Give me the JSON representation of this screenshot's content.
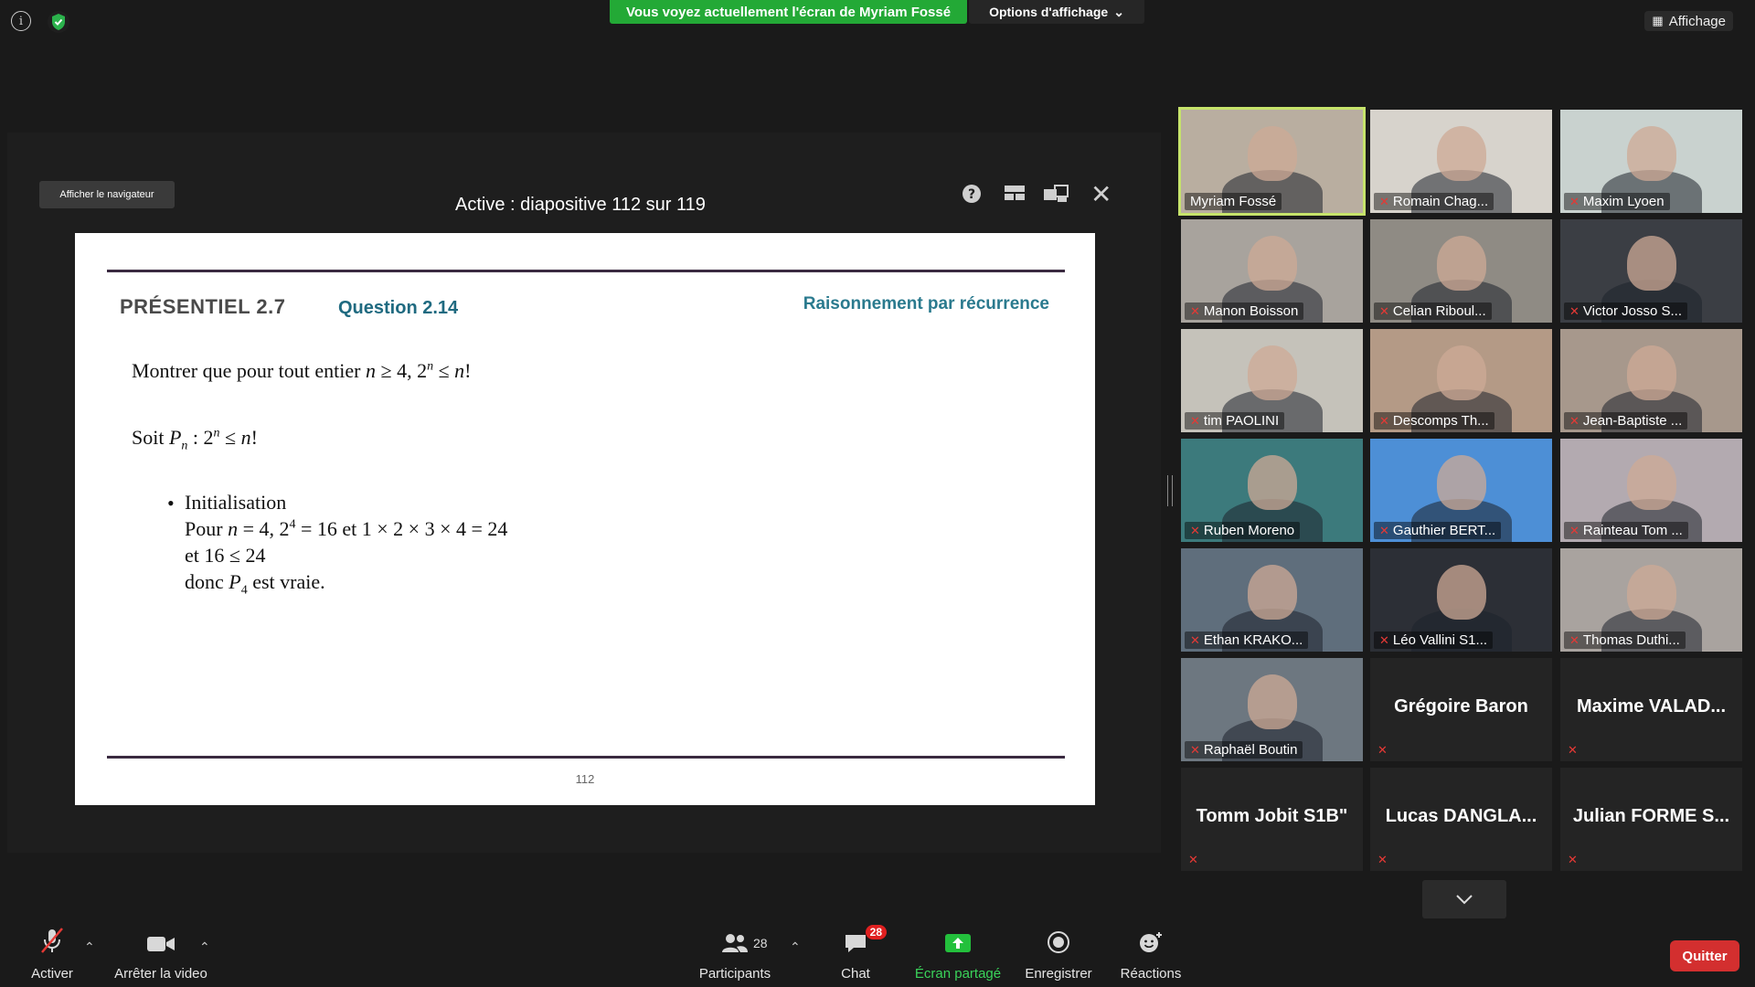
{
  "banner": {
    "share_notice": "Vous voyez actuellement l'écran de Myriam Fossé",
    "view_options": "Options d'affichage",
    "view_button": "Affichage"
  },
  "share_panel": {
    "show_navigator": "Afficher le navigateur",
    "slide_status": "Active : diapositive 112 sur 119"
  },
  "slide": {
    "section": "PRÉSENTIEL 2.7",
    "question": "Question 2.14",
    "topic": "Raisonnement par récurrence",
    "page_number": "112",
    "text_colors": {
      "section": "#4a4a4a",
      "question": "#1f6a80",
      "topic": "#2a7a8e"
    }
  },
  "participants": [
    {
      "name": "Myriam Fossé",
      "muted": false,
      "video": true,
      "speaking": true,
      "bg": "#b9aea0"
    },
    {
      "name": "Romain Chag...",
      "muted": true,
      "video": true,
      "bg": "#d7d3cc"
    },
    {
      "name": "Maxim Lyoen",
      "muted": true,
      "video": true,
      "bg": "#c9d2cf"
    },
    {
      "name": "Manon Boisson",
      "muted": true,
      "video": true,
      "bg": "#a8a39d"
    },
    {
      "name": "Celian Riboul...",
      "muted": true,
      "video": true,
      "bg": "#8f8b84"
    },
    {
      "name": "Victor Josso S...",
      "muted": true,
      "video": true,
      "bg": "#3b3e44"
    },
    {
      "name": "tim PAOLINI",
      "muted": true,
      "video": true,
      "bg": "#c5c2ba"
    },
    {
      "name": "Descomps Th...",
      "muted": true,
      "video": true,
      "bg": "#b49a86"
    },
    {
      "name": "Jean-Baptiste ...",
      "muted": true,
      "video": true,
      "bg": "#a7988c"
    },
    {
      "name": "Ruben Moreno",
      "muted": true,
      "video": true,
      "bg": "#3c7a7c"
    },
    {
      "name": "Gauthier BERT...",
      "muted": true,
      "video": true,
      "bg": "#4d8fd6"
    },
    {
      "name": "Rainteau Tom ...",
      "muted": true,
      "video": true,
      "bg": "#b3aab0"
    },
    {
      "name": "Ethan KRAKO...",
      "muted": true,
      "video": true,
      "bg": "#5f6e7c"
    },
    {
      "name": "Léo Vallini S1...",
      "muted": true,
      "video": true,
      "bg": "#2c2f36"
    },
    {
      "name": "Thomas Duthi...",
      "muted": true,
      "video": true,
      "bg": "#a9a39f"
    },
    {
      "name": "Raphaël Boutin",
      "muted": true,
      "video": true,
      "bg": "#6d7780"
    },
    {
      "name": "Grégoire Baron",
      "muted": true,
      "video": false
    },
    {
      "name": "Maxime  VALAD...",
      "muted": true,
      "video": false
    },
    {
      "name": "Tomm Jobit S1B\"",
      "muted": true,
      "video": false
    },
    {
      "name": "Lucas  DANGLA...",
      "muted": true,
      "video": false
    },
    {
      "name": "Julian  FORME  S...",
      "muted": true,
      "video": false
    }
  ],
  "toolbar": {
    "mic_label": "Activer",
    "video_label": "Arrêter la video",
    "participants_label": "Participants",
    "participants_count": "28",
    "chat_label": "Chat",
    "chat_badge": "28",
    "share_label": "Écran partagé",
    "record_label": "Enregistrer",
    "reactions_label": "Réactions",
    "quit_label": "Quitter"
  }
}
